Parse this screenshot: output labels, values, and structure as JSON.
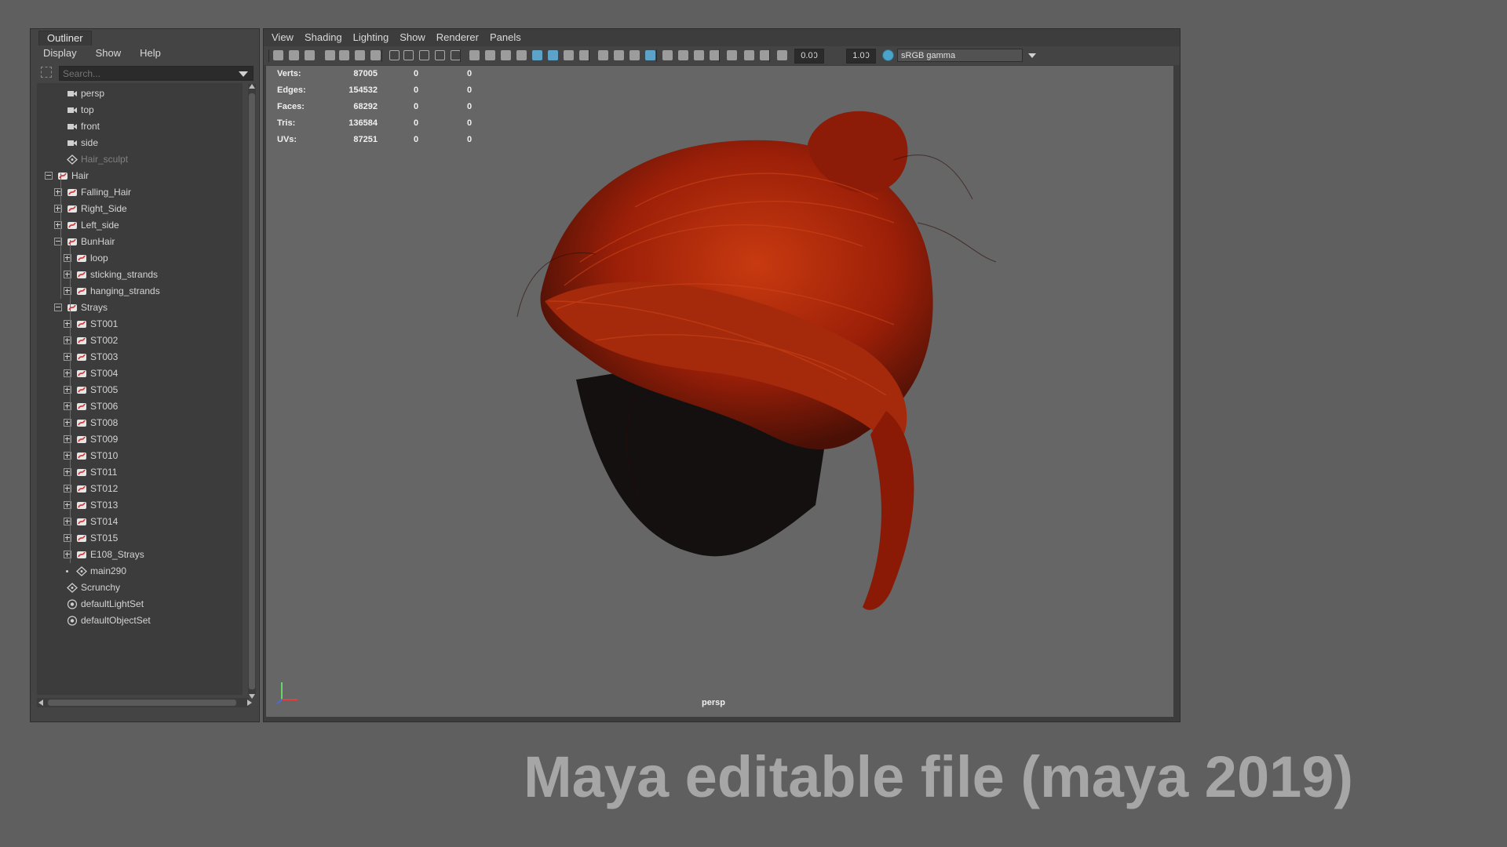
{
  "outliner": {
    "title": "Outliner",
    "menu": [
      "Display",
      "Show",
      "Help"
    ],
    "search_placeholder": "Search...",
    "items": [
      {
        "label": "persp",
        "icon": "camera-icon"
      },
      {
        "label": "top",
        "icon": "camera-icon"
      },
      {
        "label": "front",
        "icon": "camera-icon"
      },
      {
        "label": "side",
        "icon": "camera-icon"
      },
      {
        "label": "Hair_sculpt",
        "icon": "transform-icon"
      },
      {
        "label": "Hair",
        "icon": "xgen-curve-icon"
      },
      {
        "label": "Falling_Hair",
        "icon": "xgen-curve-icon"
      },
      {
        "label": "Right_Side",
        "icon": "xgen-curve-icon"
      },
      {
        "label": "Left_side",
        "icon": "xgen-curve-icon"
      },
      {
        "label": "BunHair",
        "icon": "xgen-curve-icon"
      },
      {
        "label": "loop",
        "icon": "xgen-curve-icon"
      },
      {
        "label": "sticking_strands",
        "icon": "xgen-curve-icon"
      },
      {
        "label": "hanging_strands",
        "icon": "xgen-curve-icon"
      },
      {
        "label": "Strays",
        "icon": "xgen-curve-icon"
      },
      {
        "label": "ST001",
        "icon": "xgen-curve-icon"
      },
      {
        "label": "ST002",
        "icon": "xgen-curve-icon"
      },
      {
        "label": "ST003",
        "icon": "xgen-curve-icon"
      },
      {
        "label": "ST004",
        "icon": "xgen-curve-icon"
      },
      {
        "label": "ST005",
        "icon": "xgen-curve-icon"
      },
      {
        "label": "ST006",
        "icon": "xgen-curve-icon"
      },
      {
        "label": "ST008",
        "icon": "xgen-curve-icon"
      },
      {
        "label": "ST009",
        "icon": "xgen-curve-icon"
      },
      {
        "label": "ST010",
        "icon": "xgen-curve-icon"
      },
      {
        "label": "ST011",
        "icon": "xgen-curve-icon"
      },
      {
        "label": "ST012",
        "icon": "xgen-curve-icon"
      },
      {
        "label": "ST013",
        "icon": "xgen-curve-icon"
      },
      {
        "label": "ST014",
        "icon": "xgen-curve-icon"
      },
      {
        "label": "ST015",
        "icon": "xgen-curve-icon"
      },
      {
        "label": "E108_Strays",
        "icon": "xgen-curve-icon"
      },
      {
        "label": "main290",
        "icon": "transform-icon"
      },
      {
        "label": "Scrunchy",
        "icon": "transform-icon"
      },
      {
        "label": "defaultLightSet",
        "icon": "set-icon"
      },
      {
        "label": "defaultObjectSet",
        "icon": "set-icon"
      }
    ]
  },
  "viewport": {
    "menu": [
      "View",
      "Shading",
      "Lighting",
      "Show",
      "Renderer",
      "Panels"
    ],
    "exposure": "0.00",
    "gamma": "1.00",
    "color_space": "sRGB gamma",
    "camera_label": "persp",
    "stats": [
      {
        "label": "Verts:",
        "v1": "87005",
        "v2": "0",
        "v3": "0"
      },
      {
        "label": "Edges:",
        "v1": "154532",
        "v2": "0",
        "v3": "0"
      },
      {
        "label": "Faces:",
        "v1": "68292",
        "v2": "0",
        "v3": "0"
      },
      {
        "label": "Tris:",
        "v1": "136584",
        "v2": "0",
        "v3": "0"
      },
      {
        "label": "UVs:",
        "v1": "87251",
        "v2": "0",
        "v3": "0"
      }
    ],
    "hair_color": "#b3260c"
  },
  "caption": "Maya editable file (maya 2019)"
}
